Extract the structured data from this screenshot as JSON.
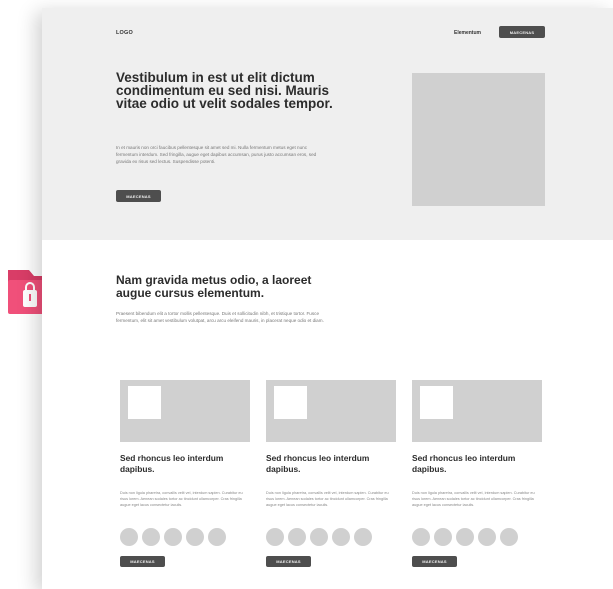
{
  "header": {
    "logo": "LOGO",
    "nav_link": "Elementum",
    "nav_button": "MAECENAS"
  },
  "hero": {
    "title": "Vestibulum in est ut elit dictum condimentum eu sed nisi. Mauris vitae odio ut velit sodales tempor.",
    "text": "In et mauris non orci faucibus pellentesque sit amet sed mi. Nulla fermentum metus eget nunc fermentum interdum. Sed fringilla, augue eget dapibus accumsan, purus justo accumsan eros, sed gravida ex risus sed lectus. Suspendisse potenti.",
    "button": "MAECENAS"
  },
  "section2": {
    "title": "Nam gravida metus odio, a laoreet augue cursus elementum.",
    "text": "Praesent bibendum elit a tortor mollis pellentesque. Duis et sollicitudin nibh, et tristique tortor. Fusce fermentum, elit sit amet vestibulum volutpat, arcu arcu eleifend mauris, in placerat neque odio et diam."
  },
  "cards": [
    {
      "title": "Sed rhoncus leo interdum dapibus.",
      "text": "Duis non ligula pharetra, convallis velit vel, interdum sapien. Curabitur eu risus lorem. Aenean sodales tortor ac tincidunt ullamcorper. Cras fringilla augue eget lacus consectetur iaculis.",
      "button": "MAECENAS"
    },
    {
      "title": "Sed rhoncus leo interdum dapibus.",
      "text": "Duis non ligula pharetra, convallis velit vel, interdum sapien. Curabitur eu risus lorem. Aenean sodales tortor ac tincidunt ullamcorper. Cras fringilla augue eget lacus consectetur iaculis.",
      "button": "MAECENAS"
    },
    {
      "title": "Sed rhoncus leo interdum dapibus.",
      "text": "Duis non ligula pharetra, convallis velit vel, interdum sapien. Curabitur eu risus lorem. Aenean sodales tortor ac tincidunt ullamcorper. Cras fringilla augue eget lacus consectetur iaculis.",
      "button": "MAECENAS"
    }
  ],
  "icons": {
    "folder": "locked-folder-icon"
  },
  "colors": {
    "accent": "#f0507a",
    "accent_dark": "#d93d67",
    "button": "#4e4e4e",
    "placeholder": "#d0d0d0",
    "hero_bg": "#efefef"
  }
}
